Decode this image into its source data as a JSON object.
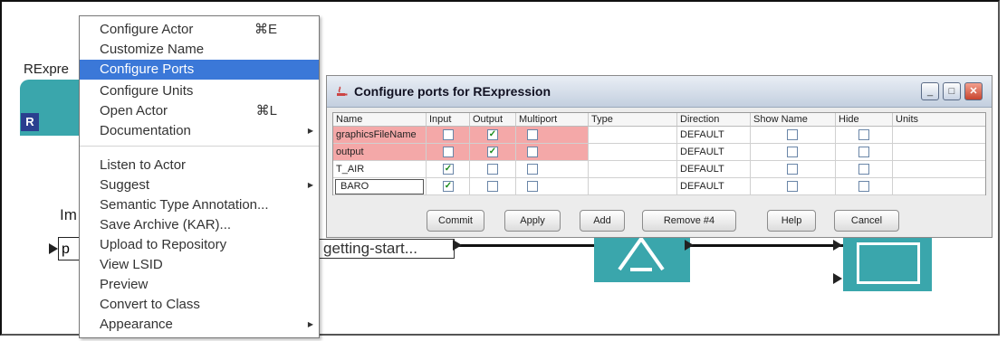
{
  "canvas": {
    "actor_label": "RExpre",
    "partial_label": "Im",
    "left_box_text": "p",
    "getting_started": "getting-start..."
  },
  "actor_badge": "R",
  "menu": {
    "items": [
      {
        "label": "Configure Actor",
        "shortcut": "⌘E"
      },
      {
        "label": "Customize Name",
        "shortcut": ""
      },
      {
        "label": "Configure Ports",
        "shortcut": ""
      },
      {
        "label": "Configure Units",
        "shortcut": ""
      },
      {
        "label": "Open Actor",
        "shortcut": "⌘L"
      },
      {
        "label": "Documentation",
        "shortcut": ""
      },
      {
        "label": "Listen to Actor",
        "shortcut": ""
      },
      {
        "label": "Suggest",
        "shortcut": ""
      },
      {
        "label": "Semantic Type Annotation...",
        "shortcut": ""
      },
      {
        "label": "Save Archive (KAR)...",
        "shortcut": ""
      },
      {
        "label": "Upload to Repository",
        "shortcut": ""
      },
      {
        "label": "View LSID",
        "shortcut": ""
      },
      {
        "label": "Preview",
        "shortcut": ""
      },
      {
        "label": "Convert to Class",
        "shortcut": ""
      },
      {
        "label": "Appearance",
        "shortcut": ""
      }
    ],
    "highlighted": "Configure Ports",
    "highlight_color": "#3b78d8"
  },
  "dialog": {
    "title": "Configure ports for RExpression",
    "columns": [
      "Name",
      "Input",
      "Output",
      "Multiport",
      "Type",
      "Direction",
      "Show Name",
      "Hide",
      "Units"
    ],
    "rows": [
      {
        "name": "graphicsFileName",
        "input": false,
        "output": true,
        "multiport": false,
        "type": "",
        "direction": "DEFAULT",
        "show_name": false,
        "hide": false,
        "units": "",
        "highlight": true
      },
      {
        "name": "output",
        "input": false,
        "output": true,
        "multiport": false,
        "type": "",
        "direction": "DEFAULT",
        "show_name": false,
        "hide": false,
        "units": "",
        "highlight": true
      },
      {
        "name": "T_AIR",
        "input": true,
        "output": false,
        "multiport": false,
        "type": "",
        "direction": "DEFAULT",
        "show_name": false,
        "hide": false,
        "units": "",
        "highlight": false
      },
      {
        "name": "BARO",
        "input": true,
        "output": false,
        "multiport": false,
        "type": "",
        "direction": "DEFAULT",
        "show_name": false,
        "hide": false,
        "units": "",
        "highlight": false
      }
    ],
    "buttons": {
      "commit": "Commit",
      "apply": "Apply",
      "add": "Add",
      "remove": "Remove #4",
      "help": "Help",
      "cancel": "Cancel"
    },
    "highlight_color": "#f4a8a8",
    "check_color": "#1a8a1a"
  },
  "window_buttons": {
    "minimize": "_",
    "maximize": "□",
    "close": "✕"
  }
}
